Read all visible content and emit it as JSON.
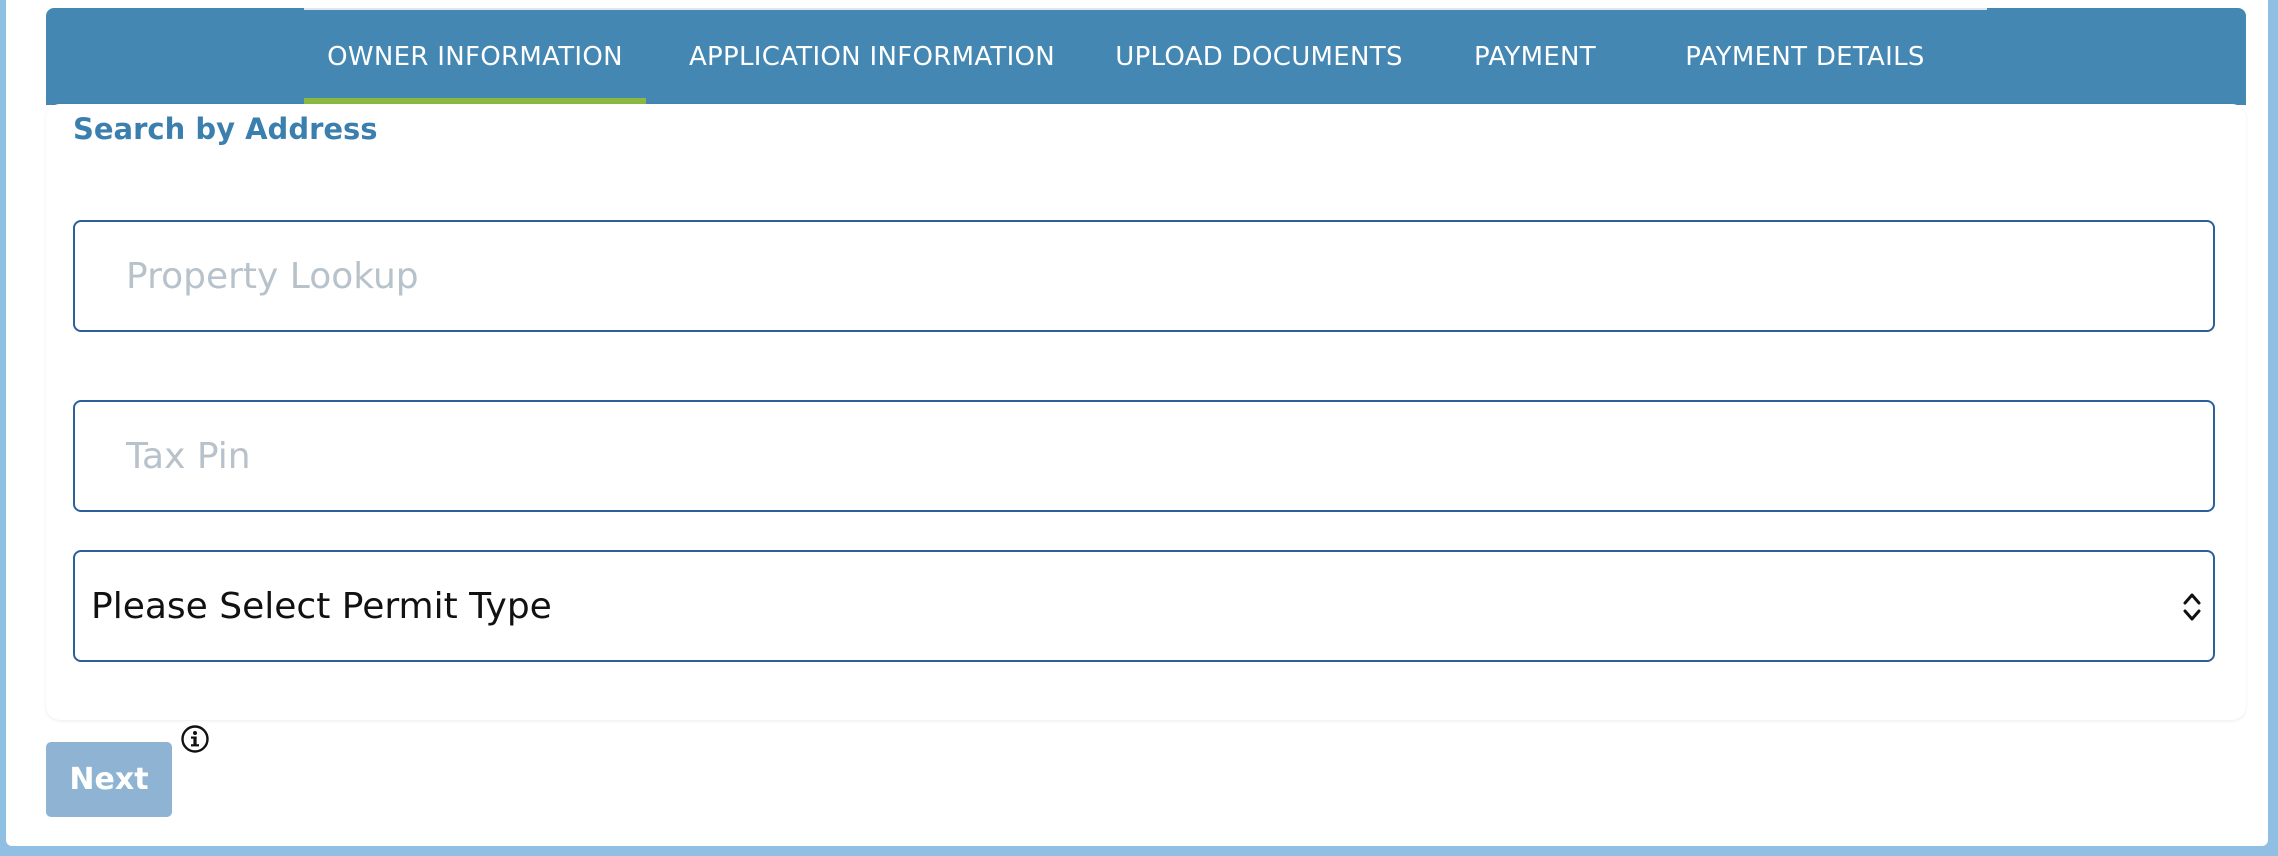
{
  "tabs": [
    {
      "label": "OWNER INFORMATION",
      "active": true
    },
    {
      "label": "APPLICATION INFORMATION",
      "active": false
    },
    {
      "label": "UPLOAD DOCUMENTS",
      "active": false
    },
    {
      "label": "PAYMENT",
      "active": false
    },
    {
      "label": "PAYMENT DETAILS",
      "active": false
    }
  ],
  "form": {
    "section_title": "Search by Address",
    "property_lookup": {
      "placeholder": "Property Lookup",
      "value": ""
    },
    "tax_pin": {
      "placeholder": "Tax Pin",
      "value": ""
    },
    "permit_type": {
      "selected": "Please Select Permit Type"
    }
  },
  "actions": {
    "next_label": "Next",
    "info_icon": "info-icon"
  },
  "colors": {
    "tabbar": "#4487b2",
    "active_tab_underline": "#8ab93f",
    "section_title": "#3a7fae",
    "field_border": "#2d5f9a",
    "next_button": "#8fb4d3",
    "page_border": "#8fbfe3"
  }
}
